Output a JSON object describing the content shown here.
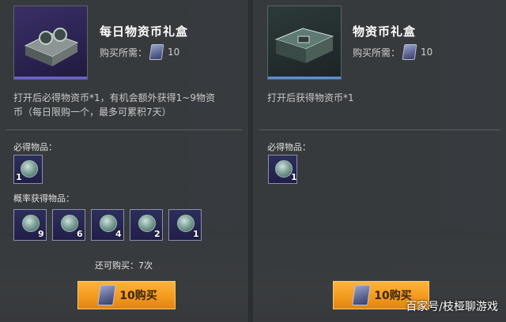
{
  "left_card": {
    "title": "每日物资币礼盒",
    "price_label": "购买所需：",
    "price_value": "10",
    "description_line1": "打开后必得物资币*1，有机会额外获得1~9物资",
    "description_line2": "币（每日限购一个，最多可累积7天）",
    "guaranteed_label": "必得物品：",
    "guaranteed_items": [
      {
        "count": "1",
        "icon": "supply-coin-icon"
      }
    ],
    "chance_label": "概率获得物品：",
    "chance_items": [
      {
        "count": "9",
        "icon": "supply-coin-icon"
      },
      {
        "count": "6",
        "icon": "supply-coin-icon"
      },
      {
        "count": "4",
        "icon": "supply-coin-icon"
      },
      {
        "count": "2",
        "icon": "supply-coin-icon"
      },
      {
        "count": "1",
        "icon": "supply-coin-icon"
      }
    ],
    "remaining_text": "还可购买：7次",
    "buy_button_label": "10购买"
  },
  "right_card": {
    "title": "物资币礼盒",
    "price_label": "购买所需：",
    "price_value": "10",
    "description_line1": "打开后获得物资币*1",
    "guaranteed_label": "必得物品：",
    "guaranteed_items": [
      {
        "count": "1",
        "icon": "supply-coin-icon"
      }
    ],
    "buy_button_label": "10购买"
  },
  "watermark": "百家号/枝桠聊游戏",
  "colors": {
    "accent_orange": "#f39a1f",
    "item_bg": "#2c2f5a",
    "panel_bg": "#363a3d"
  }
}
